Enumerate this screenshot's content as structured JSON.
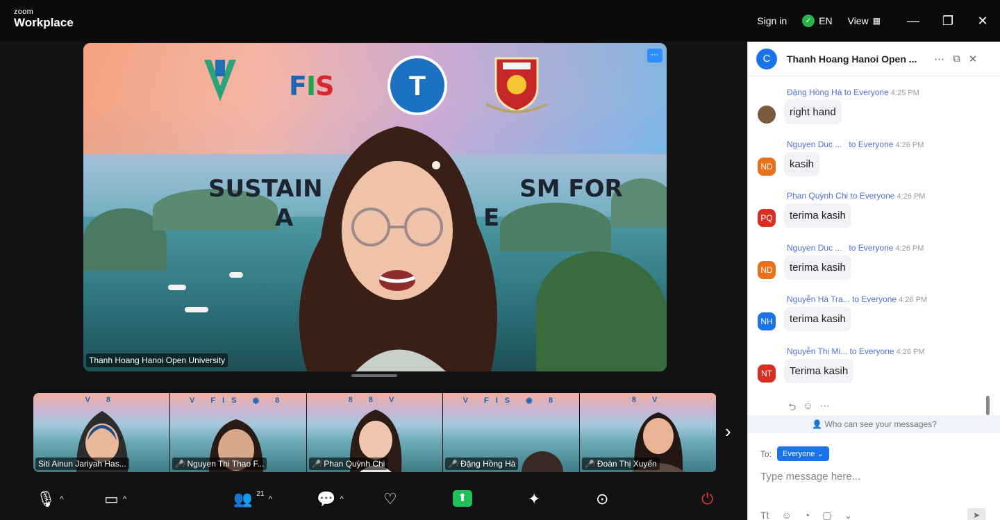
{
  "window": {
    "brand_top": "zoom",
    "brand_main": "Workplace",
    "sign_in": "Sign in",
    "language": "EN",
    "view": "View"
  },
  "main_video": {
    "slide_title_line1": "SUSTAIN",
    "slide_title_line1_end": "SM FOR",
    "slide_title_line2": "A",
    "slide_title_line2_end": "E",
    "logo_text": "FIS",
    "name": "Thanh Hoang Hanoi Open University"
  },
  "thumbnails": [
    {
      "name": "Siti Ainun Jariyah Has...",
      "muted": false
    },
    {
      "name": "Nguyen Thi Thao F...",
      "muted": true
    },
    {
      "name": "Phan Quỳnh Chi",
      "muted": true
    },
    {
      "name": "Đặng Hồng Hà",
      "muted": true
    },
    {
      "name": "Đoàn Thị Xuyến",
      "muted": true
    }
  ],
  "toolbar": {
    "participants_count": "21"
  },
  "chat": {
    "title": "Thanh Hoang Hanoi Open ...",
    "messages": [
      {
        "sender": "Đặng Hồng Hà",
        "to": "to Everyone",
        "time": "4:25 PM",
        "initials": "",
        "avatar_color": "#7a5a3c",
        "text": "right hand"
      },
      {
        "sender": "Nguyen Duc ...",
        "to": "to Everyone",
        "time": "4:26 PM",
        "initials": "ND",
        "avatar_color": "#e8711c",
        "text": "kasih"
      },
      {
        "sender": "Phan Quỳnh Chi",
        "to": "to Everyone",
        "time": "4:26 PM",
        "initials": "PQ",
        "avatar_color": "#d93025",
        "text": "terima kasih"
      },
      {
        "sender": "Nguyen Duc ...",
        "to": "to Everyone",
        "time": "4:26 PM",
        "initials": "ND",
        "avatar_color": "#e8711c",
        "text": "terima kasih"
      },
      {
        "sender": "Nguyễn Hà Tra...",
        "to": "to Everyone",
        "time": "4:26 PM",
        "initials": "NH",
        "avatar_color": "#1a73e8",
        "text": "terima kasih"
      },
      {
        "sender": "Nguyễn Thị Mi...",
        "to": "to Everyone",
        "time": "4:26 PM",
        "initials": "NT",
        "avatar_color": "#d93025",
        "text": "Terima kasih"
      }
    ],
    "who_can_see": "Who can see your messages?",
    "to_label": "To:",
    "recipient": "Everyone",
    "placeholder": "Type message here..."
  }
}
